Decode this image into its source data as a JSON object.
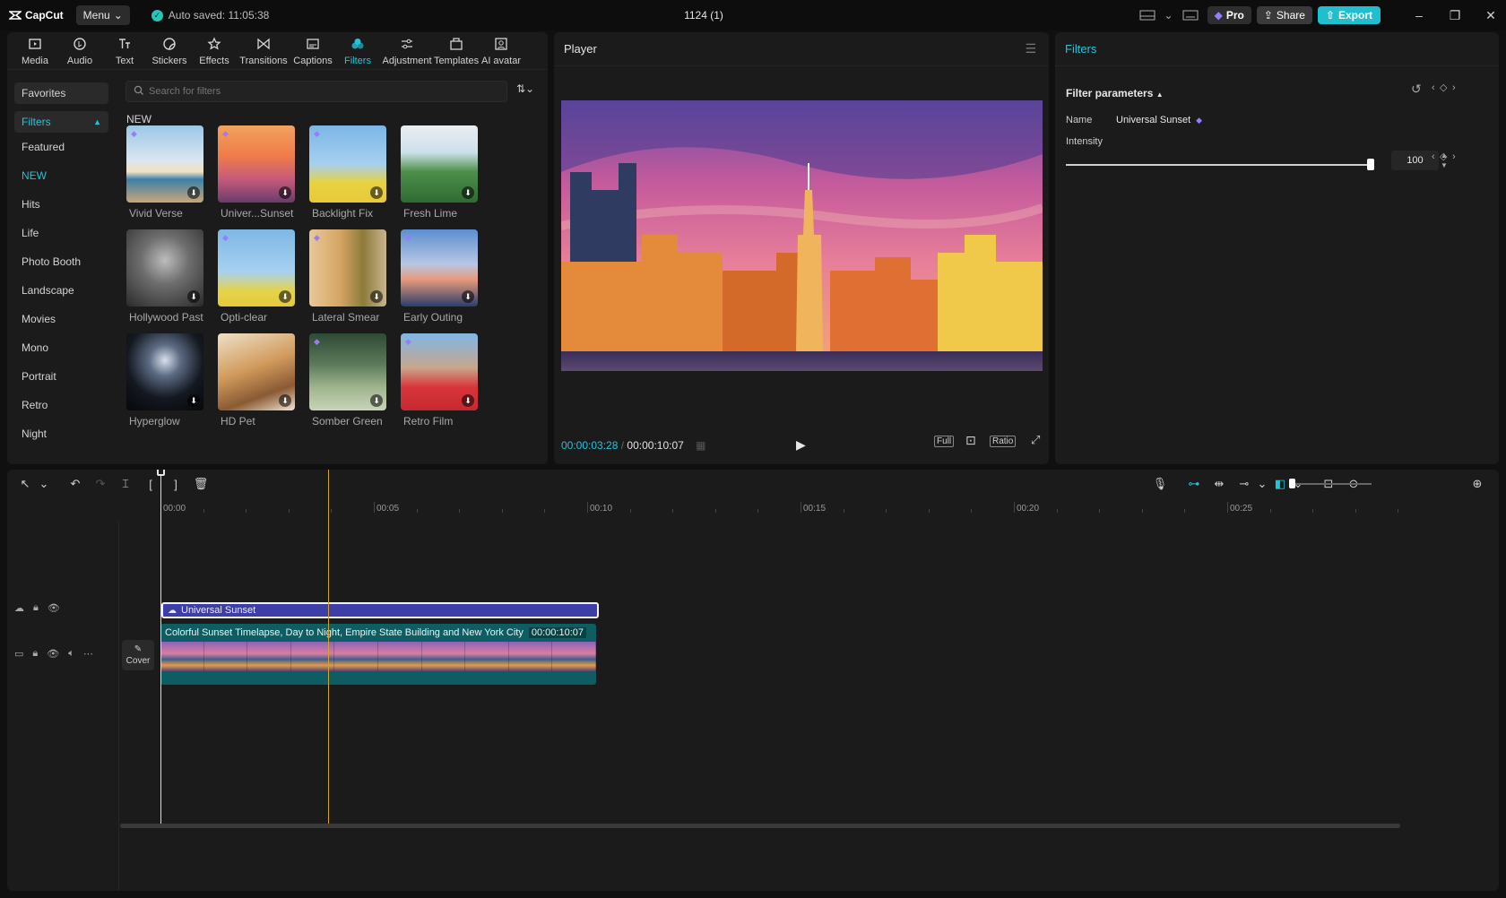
{
  "app": {
    "logo_text": "CapCut",
    "menu_label": "Menu",
    "autosave_text": "Auto saved: 11:05:38",
    "project_title": "1124 (1)",
    "pro_label": "Pro",
    "share_label": "Share",
    "export_label": "Export",
    "accent_color": "#21c4d9",
    "filter_track_color": "#3d3ea8",
    "video_track_color": "#0d5d63",
    "playhead_color": "#d4a12c"
  },
  "tools": [
    {
      "label": "Media",
      "icon": "media-icon"
    },
    {
      "label": "Audio",
      "icon": "audio-icon"
    },
    {
      "label": "Text",
      "icon": "text-icon"
    },
    {
      "label": "Stickers",
      "icon": "stickers-icon"
    },
    {
      "label": "Effects",
      "icon": "effects-icon"
    },
    {
      "label": "Transitions",
      "icon": "transitions-icon"
    },
    {
      "label": "Captions",
      "icon": "captions-icon"
    },
    {
      "label": "Filters",
      "icon": "filters-icon",
      "active": true
    },
    {
      "label": "Adjustment",
      "icon": "adjustment-icon"
    },
    {
      "label": "Templates",
      "icon": "templates-icon"
    },
    {
      "label": "AI avatar",
      "icon": "ai-avatar-icon"
    }
  ],
  "categories": {
    "favorites": "Favorites",
    "filters": "Filters",
    "items": [
      "Featured",
      "NEW",
      "Hits",
      "Life",
      "Photo Booth",
      "Landscape",
      "Movies",
      "Mono",
      "Portrait",
      "Retro",
      "Night"
    ]
  },
  "search": {
    "placeholder": "Search for filters"
  },
  "section_label": "NEW",
  "filters": [
    {
      "name": "Vivid Verse",
      "pro": true
    },
    {
      "name": "Univer...Sunset",
      "pro": true
    },
    {
      "name": "Backlight Fix",
      "pro": true
    },
    {
      "name": "Fresh Lime",
      "pro": false
    },
    {
      "name": "Hollywood Past",
      "pro": false
    },
    {
      "name": "Opti-clear",
      "pro": true
    },
    {
      "name": "Lateral Smear",
      "pro": true
    },
    {
      "name": "Early Outing",
      "pro": true
    },
    {
      "name": "Hyperglow",
      "pro": false
    },
    {
      "name": "HD Pet",
      "pro": false
    },
    {
      "name": "Somber Green",
      "pro": true
    },
    {
      "name": "Retro Film",
      "pro": true
    }
  ],
  "player": {
    "title": "Player",
    "current_time": "00:00:03:28",
    "total_time": "00:00:10:07",
    "full_label": "Full",
    "ratio_label": "Ratio"
  },
  "inspector": {
    "tab": "Filters",
    "section": "Filter parameters",
    "name_label": "Name",
    "name_value": "Universal Sunset",
    "intensity_label": "Intensity",
    "intensity_value": "100",
    "intensity_fraction": 1.0
  },
  "timeline": {
    "ticks": [
      "00:00",
      "00:05",
      "00:10",
      "00:15",
      "00:20",
      "00:25"
    ],
    "filter_clip_label": "Universal Sunset",
    "video_clip_label": "Colorful Sunset Timelapse, Day to Night, Empire State Building and New York City",
    "video_clip_duration": "00:00:10:07",
    "cover_label": "Cover"
  }
}
